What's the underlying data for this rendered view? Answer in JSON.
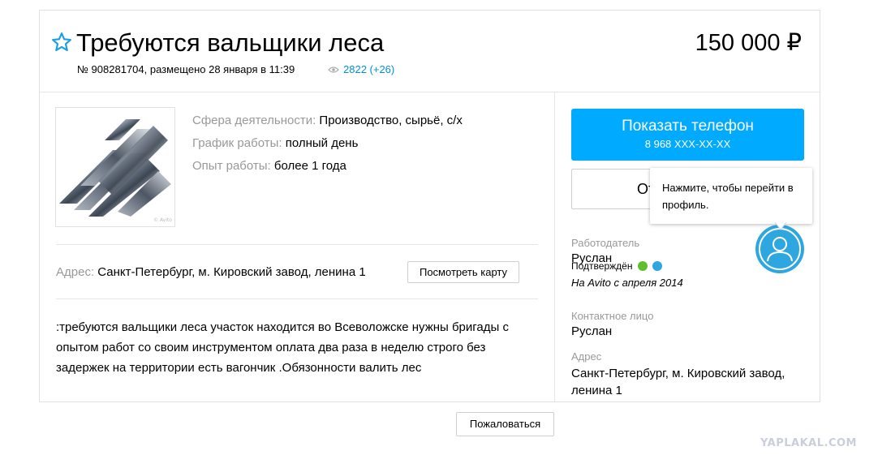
{
  "listing": {
    "title": "Требуются вальщики леса",
    "meta": "№ 908281704, размещено 28 января в 11:39",
    "views": "2822 (+26)",
    "price": "150 000 ₽"
  },
  "params": [
    {
      "key": "Сфера деятельности:",
      "value": "Производство, сырьё, с/х"
    },
    {
      "key": "График работы:",
      "value": "полный день"
    },
    {
      "key": "Опыт работы:",
      "value": "более 1 года"
    }
  ],
  "address": {
    "label": "Адрес:",
    "value": "Санкт-Петербург, м. Кировский завод, ленина 1",
    "map_button": "Посмотреть карту"
  },
  "description": ":требуются вальщики леса участок находится во Всеволожске нужны бригады с опытом работ со своим инструментом оплата два раза в неделю строго без задержек на территории есть вагончик .Обязонности валить лес",
  "sidebar": {
    "phone_button_title": "Показать телефон",
    "phone_masked": "8 968 XXX-XX-XX",
    "message_button_partial": "От",
    "employer_label": "Работодатель",
    "employer_name": "Руслан",
    "verified_label": "Подтверждён",
    "since": "На Avito с апреля 2014",
    "contact_label": "Контактное лицо",
    "contact_name": "Руслан",
    "address_label": "Адрес",
    "address_value": "Санкт-Петербург, м. Кировский завод, ленина 1"
  },
  "tooltip": {
    "text": "Нажмите, чтобы перейти в профиль."
  },
  "footer": {
    "complain_button": "Пожаловаться",
    "watermark": "YAPLAKAL.COM"
  },
  "colors": {
    "accent": "#00aaff",
    "link": "#0091d9",
    "phone_icon": "#5fbf2f",
    "mail_icon": "#2ea7e0"
  }
}
